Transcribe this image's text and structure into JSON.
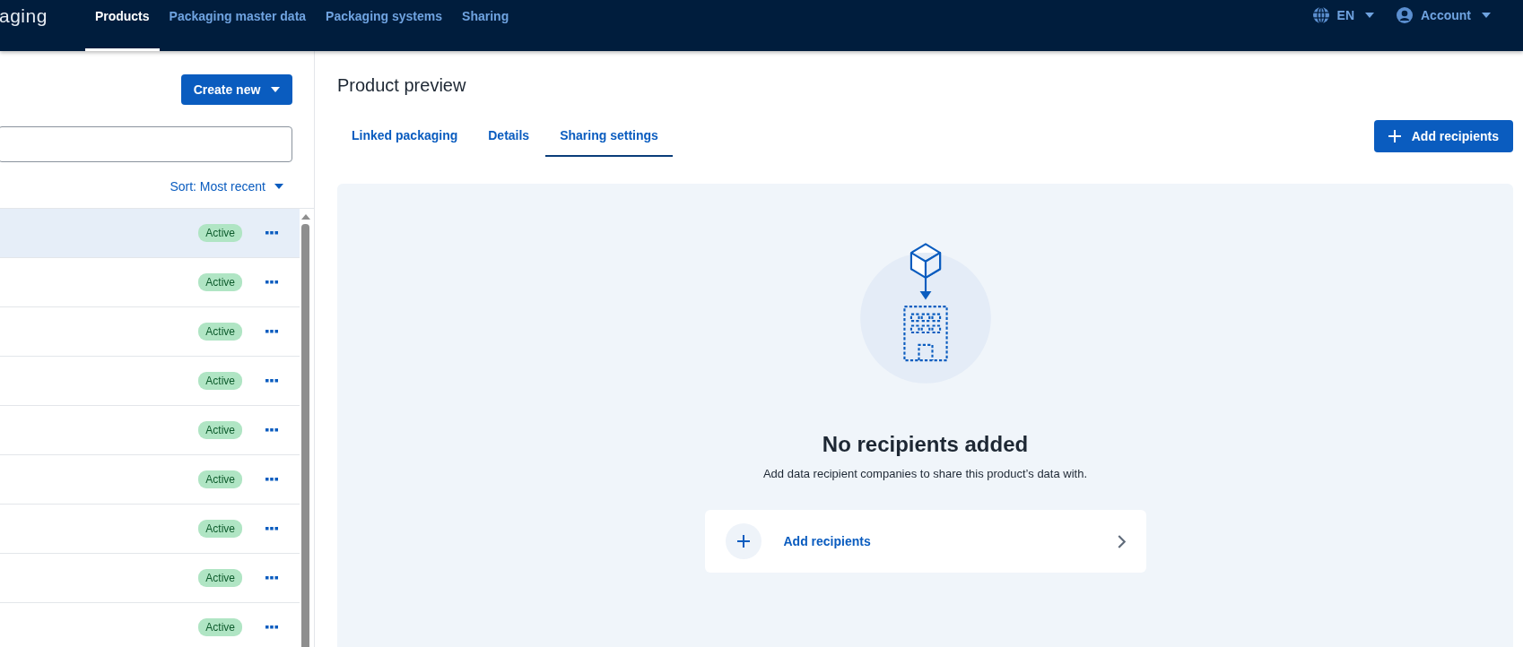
{
  "header": {
    "logo_text": "aging",
    "nav": [
      {
        "label": "Products",
        "selected": true
      },
      {
        "label": "Packaging master data",
        "selected": false
      },
      {
        "label": "Packaging systems",
        "selected": false
      },
      {
        "label": "Sharing",
        "selected": false
      }
    ],
    "language": "EN",
    "account": "Account"
  },
  "product_list": {
    "create_button": "Create new",
    "sort": "Sort: Most recent",
    "rows": [
      {
        "status": "Active",
        "selected": true
      },
      {
        "status": "Active",
        "selected": false
      },
      {
        "status": "Active",
        "selected": false
      },
      {
        "status": "Active",
        "selected": false
      },
      {
        "status": "Active",
        "selected": false
      },
      {
        "status": "Active",
        "selected": false
      },
      {
        "status": "Active",
        "selected": false
      },
      {
        "status": "Active",
        "selected": false
      },
      {
        "status": "Active",
        "selected": false
      }
    ]
  },
  "preview": {
    "title": "Product preview",
    "tabs": [
      {
        "label": "Linked packaging",
        "selected": false
      },
      {
        "label": "Details",
        "selected": false
      },
      {
        "label": "Sharing settings",
        "selected": true
      }
    ],
    "add_button": "Add recipients",
    "empty_state": {
      "title": "No recipients added",
      "description": "Add data recipient companies to share this product’s data with.",
      "action": "Add recipients"
    }
  }
}
